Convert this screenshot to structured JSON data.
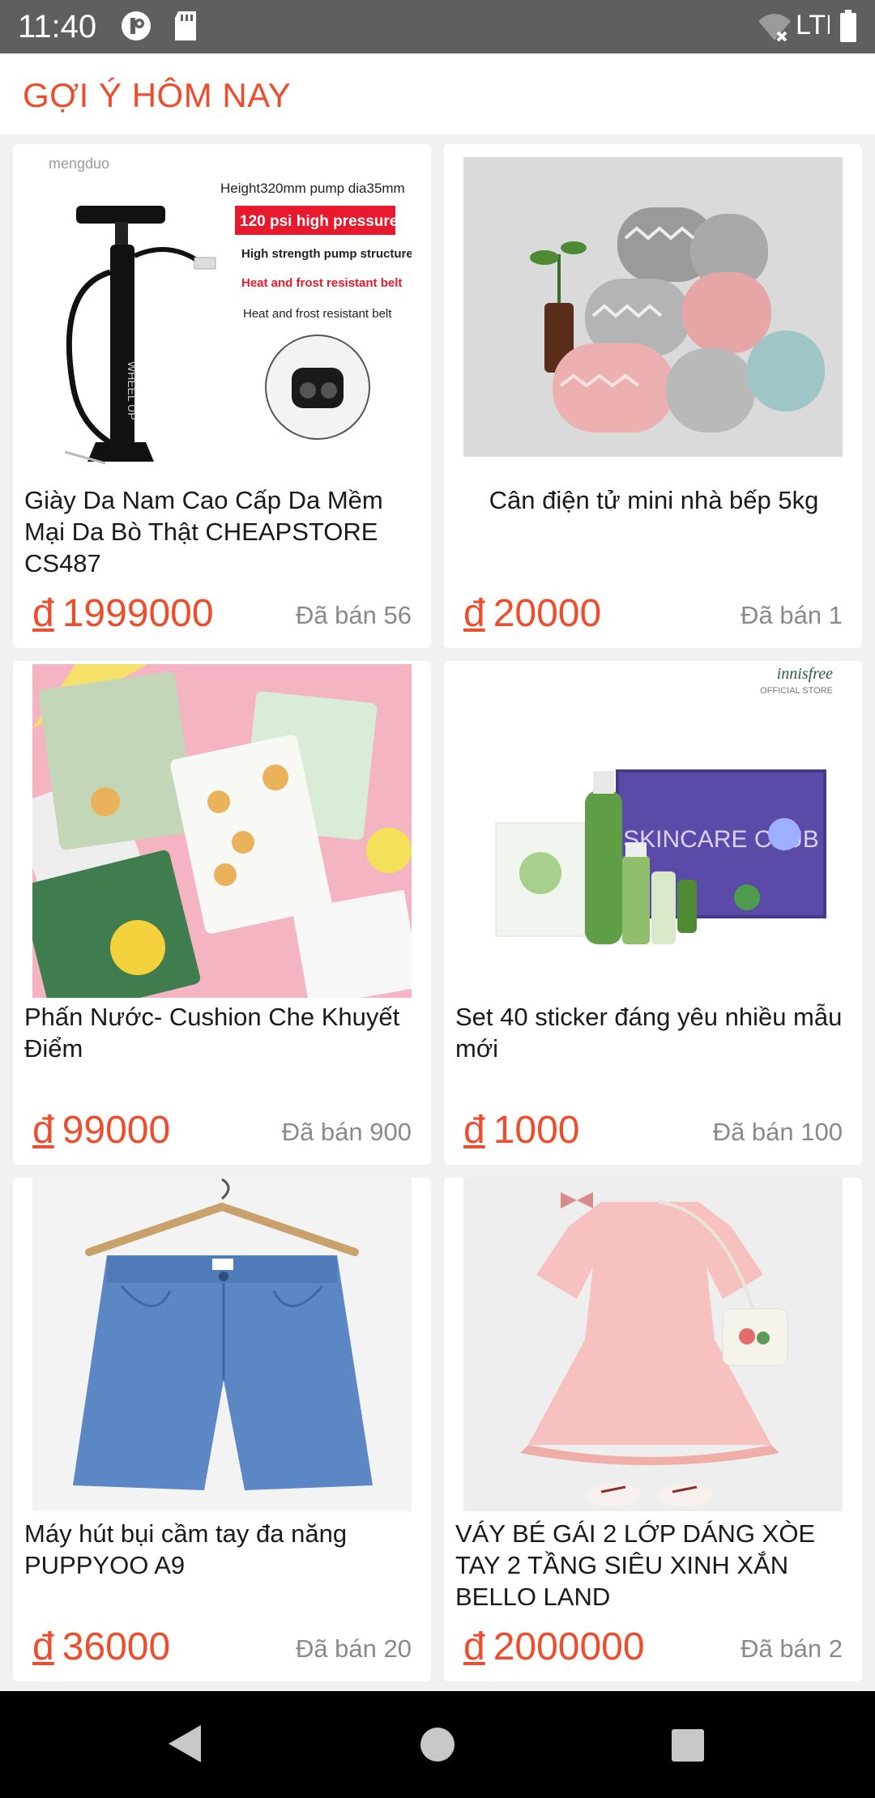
{
  "status_bar": {
    "time": "11:40",
    "network": "LTE"
  },
  "header": {
    "title": "GỢI Ý HÔM NAY"
  },
  "products": [
    {
      "title": "Giày Da Nam Cao Cấp Da Mềm Mại Da Bò Thật CHEAPSTORE CS487",
      "currency": "đ",
      "price": "1999000",
      "sold": "Đã bán 56",
      "image": {
        "brand": "mengduo",
        "spec": "Height320mm pump dia35mm",
        "badge": "120 psi high pressure",
        "line1": "High strength pump structure",
        "line2": "Heat and frost resistant belt",
        "line3": "Heat and frost resistant belt"
      }
    },
    {
      "title": "Cân điện tử mini nhà bếp 5kg",
      "currency": "đ",
      "price": "20000",
      "sold": "Đã bán 1"
    },
    {
      "title": "Phấn Nước- Cushion Che Khuyết Điểm",
      "currency": "đ",
      "price": "99000",
      "sold": "Đã bán 900"
    },
    {
      "title": "Set 40 sticker đáng yêu nhiều mẫu mới",
      "currency": "đ",
      "price": "1000",
      "sold": "Đã bán 100",
      "image": {
        "brand": "innisfree",
        "store": "OFFICIAL STORE",
        "box_text": "SKINCARE CLUB"
      }
    },
    {
      "title": "Máy hút bụi cầm tay đa năng PUPPYOO A9",
      "currency": "đ",
      "price": "36000",
      "sold": "Đã bán 20"
    },
    {
      "title": "VÁY BÉ GÁI 2 LỚP DÁNG XÒE TAY 2 TẦNG SIÊU XINH XẮN BELLO LAND",
      "currency": "đ",
      "price": "2000000",
      "sold": "Đã bán 2"
    }
  ],
  "colors": {
    "accent": "#ee4d2d",
    "status_bar": "#5f5f5f",
    "nav_bar": "#000000",
    "background": "#f1f1f1"
  }
}
